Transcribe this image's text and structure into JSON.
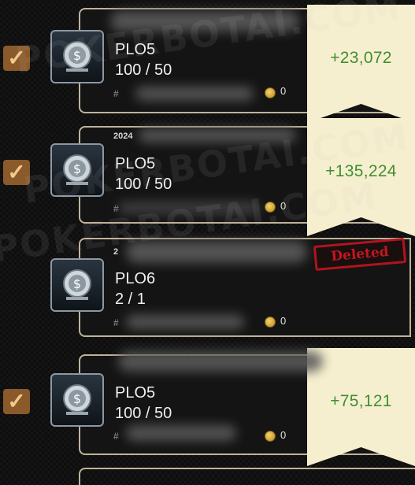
{
  "watermark": "POKERBOTAI.COM",
  "rows": [
    {
      "selected": true,
      "date": "",
      "game": "PLO5",
      "stakes": "100 / 50",
      "table_id": "#",
      "coins": "0",
      "result": "+23,072",
      "deleted": false
    },
    {
      "selected": true,
      "date": "2024",
      "game": "PLO5",
      "stakes": "100 / 50",
      "table_id": "#",
      "coins": "0",
      "result": "+135,224",
      "deleted": false
    },
    {
      "selected": false,
      "date": "2",
      "game": "PLO6",
      "stakes": "2 / 1",
      "table_id": "#",
      "coins": "0",
      "result": "",
      "deleted": true,
      "deleted_label": "Deleted"
    },
    {
      "selected": true,
      "date": "",
      "game": "PLO5",
      "stakes": "100 / 50",
      "table_id": "#",
      "coins": "0",
      "result": "+75,121",
      "deleted": false
    }
  ],
  "colors": {
    "result_text": "#3f8f32",
    "result_bg": "#f6efcf",
    "check_bg": "#8a5a2a",
    "card_border": "#bfb39a",
    "deleted_stamp": "#c4161f"
  },
  "icons": {
    "check": "checkmark-icon",
    "avatar": "poker-chip-icon",
    "coin": "coin-icon"
  }
}
